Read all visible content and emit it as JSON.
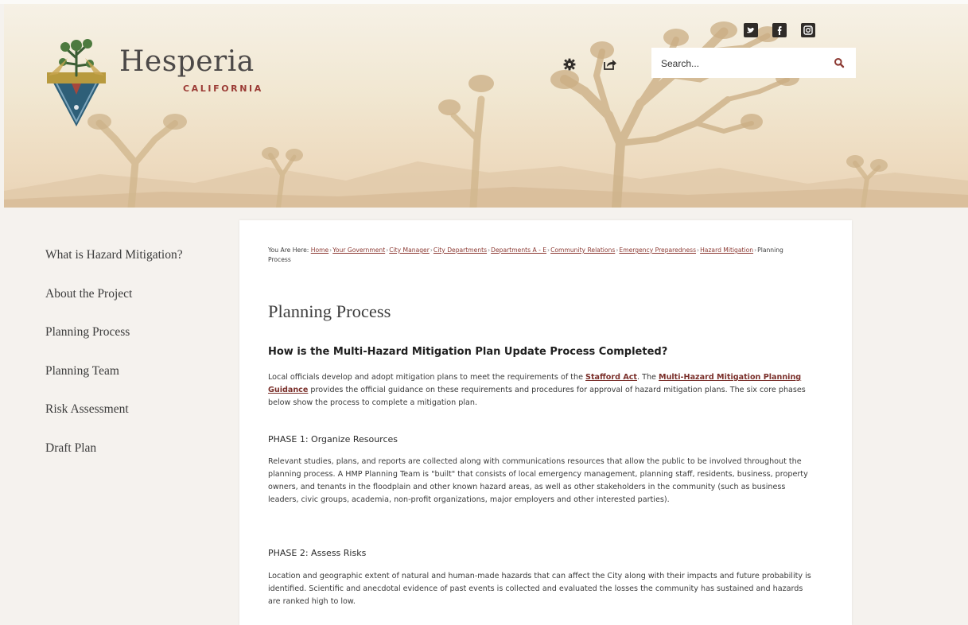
{
  "site": {
    "name": "Hesperia",
    "state": "CALIFORNIA"
  },
  "icons": {
    "twitter": "twitter-icon",
    "facebook": "facebook-icon",
    "instagram": "instagram-icon",
    "settings": "gear-icon",
    "share": "share-icon",
    "search": "search-icon"
  },
  "search": {
    "placeholder": "Search..."
  },
  "sidebar": {
    "items": [
      {
        "label": "What is Hazard Mitigation?"
      },
      {
        "label": "About the Project"
      },
      {
        "label": "Planning Process"
      },
      {
        "label": "Planning Team"
      },
      {
        "label": "Risk Assessment"
      },
      {
        "label": "Draft Plan"
      }
    ]
  },
  "breadcrumb": {
    "prefix": "You Are Here:",
    "links": [
      "Home",
      "Your Government",
      "City Manager",
      "City Departments",
      "Departments A - E",
      "Community Relations",
      "Emergency Preparedness",
      "Hazard Mitigation"
    ],
    "current": "Planning Process",
    "separator": "›"
  },
  "page": {
    "title": "Planning Process",
    "heading": "How is the Multi-Hazard Mitigation Plan Update Process Completed?",
    "intro": {
      "part1": "Local officials develop and adopt mitigation plans to meet the requirements of the ",
      "link1": "Stafford Act",
      "part2": ". The ",
      "link2": "Multi-Hazard Mitigation Planning Guidance",
      "part3": " provides the official guidance on these requirements and procedures for approval of hazard mitigation plans. The six core phases below show the process to complete a mitigation plan."
    },
    "phases": [
      {
        "title": "PHASE 1: Organize Resources",
        "text": "Relevant studies, plans, and reports are collected along with communications resources that allow the public to be involved throughout the planning process.  A HMP Planning Team is \"built\" that consists of local emergency management, planning staff, residents, business, property owners, and tenants in the floodplain and other known hazard areas, as well as other stakeholders in the community (such as business leaders, civic groups, academia, non-profit organizations, major employers and other interested parties)."
      },
      {
        "title": "PHASE 2: Assess Risks",
        "text": "Location and geographic extent of natural and human-made hazards that can affect the City along with their impacts and future probability is identified.  Scientific and anecdotal evidence of past events is collected and evaluated the losses the community has sustained and hazards are ranked high to low."
      }
    ]
  },
  "colors": {
    "accent": "#8c3a33",
    "link": "#7a2f2a",
    "background": "#f5f2ee"
  }
}
